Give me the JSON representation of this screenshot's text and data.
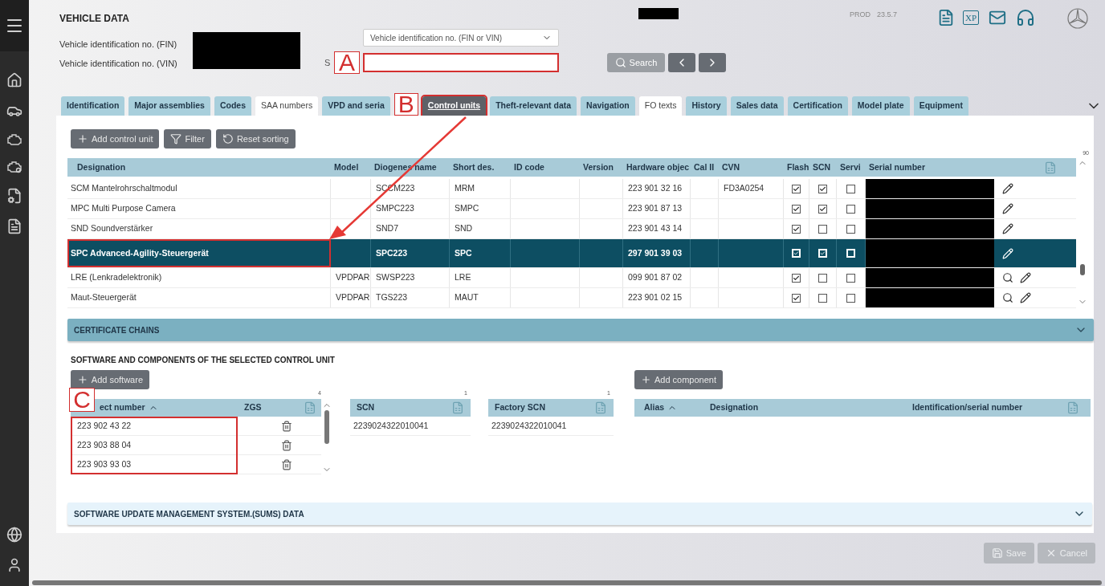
{
  "header": {
    "title": "VEHICLE DATA",
    "environment": "PROD",
    "version": "23.5.7",
    "xp_badge": "XP"
  },
  "vehicle": {
    "fields": [
      {
        "label": "Vehicle identification no. (FIN)"
      },
      {
        "label": "Vehicle identification no. (VIN)"
      }
    ],
    "search_type": {
      "value": "Vehicle identification no. (FIN or VIN)"
    },
    "search_label": "S",
    "search_button": "Search"
  },
  "tabs": [
    {
      "label": "Identification",
      "kind": "blue",
      "selected": false
    },
    {
      "label": "Major assemblies",
      "kind": "blue",
      "selected": false
    },
    {
      "label": "Codes",
      "kind": "blue",
      "selected": false
    },
    {
      "label": "SAA numbers",
      "kind": "plain",
      "selected": false
    },
    {
      "label": "VPD and seria",
      "kind": "blue",
      "selected": false
    },
    {
      "label": "Control units",
      "kind": "blue",
      "selected": true
    },
    {
      "label": "Theft-relevant data",
      "kind": "blue",
      "selected": false
    },
    {
      "label": "Navigation",
      "kind": "blue",
      "selected": false
    },
    {
      "label": "FO texts",
      "kind": "plain",
      "selected": false
    },
    {
      "label": "History",
      "kind": "blue",
      "selected": false
    },
    {
      "label": "Sales data",
      "kind": "blue",
      "selected": false
    },
    {
      "label": "Certification",
      "kind": "blue",
      "selected": false
    },
    {
      "label": "Model plate",
      "kind": "blue",
      "selected": false
    },
    {
      "label": "Equipment",
      "kind": "blue",
      "selected": false
    }
  ],
  "control_units": {
    "toolbar": [
      {
        "label": "Add control unit",
        "kind": "add"
      },
      {
        "label": "Filter",
        "kind": "filter"
      },
      {
        "label": "Reset sorting",
        "kind": "reset"
      }
    ],
    "count": "90",
    "columns": [
      "Designation",
      "Model",
      "Diogenes name",
      "Short des.",
      "ID code",
      "Version",
      "Hardware objec",
      "Cal II",
      "CVN",
      "Flash",
      "SCN",
      "Servi",
      "Serial number"
    ],
    "rows": [
      {
        "designation": "SCM Mantelrohrschaltmodul",
        "diogenes_name": "SCCM223",
        "short_designation": "MRM",
        "hardware_object": "223 901 32 16",
        "cvn": "FD3A0254",
        "flash": true,
        "scn": true,
        "service": false,
        "searchable": false,
        "selected": false
      },
      {
        "designation": "MPC Multi Purpose Camera",
        "diogenes_name": "SMPC223",
        "short_designation": "SMPC",
        "hardware_object": "223 901 87 13",
        "flash": true,
        "scn": true,
        "service": false,
        "searchable": false,
        "selected": false
      },
      {
        "designation": "SND Soundverstärker",
        "diogenes_name": "SND7",
        "short_designation": "SND",
        "hardware_object": "223 901 43 14",
        "flash": true,
        "scn": false,
        "service": false,
        "searchable": false,
        "selected": false
      },
      {
        "designation": "SPC Advanced-Agility-Steuergerät",
        "diogenes_name": "SPC223",
        "short_designation": "SPC",
        "hardware_object": "297 901 39 03",
        "flash": true,
        "scn": true,
        "service": false,
        "searchable": false,
        "selected": true
      },
      {
        "designation": "LRE (Lenkradelektronik)",
        "model": "VPDPAR",
        "diogenes_name": "SWSP223",
        "short_designation": "LRE",
        "hardware_object": "099 901 87 02",
        "flash": true,
        "scn": false,
        "service": false,
        "searchable": true,
        "selected": false
      },
      {
        "designation": "Maut-Steuergerät",
        "model": "VPDPAR",
        "diogenes_name": "TGS223",
        "short_designation": "MAUT",
        "hardware_object": "223 901 02 15",
        "flash": true,
        "scn": false,
        "service": false,
        "searchable": true,
        "selected": false
      }
    ]
  },
  "certificate_chains": {
    "title": "CERTIFICATE CHAINS",
    "expanded": false
  },
  "software": {
    "title": "SOFTWARE AND COMPONENTS OF THE SELECTED CONTROL UNIT",
    "add_software": "Add software",
    "add_component": "Add component",
    "object_table": {
      "count": "4",
      "columns": [
        {
          "label": "ect number",
          "sorted": true
        },
        {
          "label": "ZGS",
          "sorted": false
        }
      ],
      "rows": [
        "223 902 43 22",
        "223 903 88 04",
        "223 903 93 03"
      ]
    },
    "scn_table": {
      "count": "1",
      "column": "SCN",
      "rows": [
        "2239024322010041"
      ]
    },
    "factory_scn_table": {
      "count": "1",
      "column": "Factory SCN",
      "rows": [
        "2239024322010041"
      ]
    },
    "component_columns": [
      {
        "label": "Alias",
        "sorted": true
      },
      {
        "label": "Designation",
        "sorted": false
      },
      {
        "label": "Identification/serial number",
        "sorted": false
      }
    ]
  },
  "sums": {
    "title": "SOFTWARE UPDATE MANAGEMENT SYSTEM.(SUMS) DATA",
    "expanded": false
  },
  "footer_buttons": [
    {
      "label": "Save",
      "kind": "save",
      "disabled": true
    },
    {
      "label": "Cancel",
      "kind": "cancel",
      "disabled": true
    }
  ],
  "annotations": [
    {
      "label": "A"
    },
    {
      "label": "B"
    },
    {
      "label": "C"
    }
  ]
}
